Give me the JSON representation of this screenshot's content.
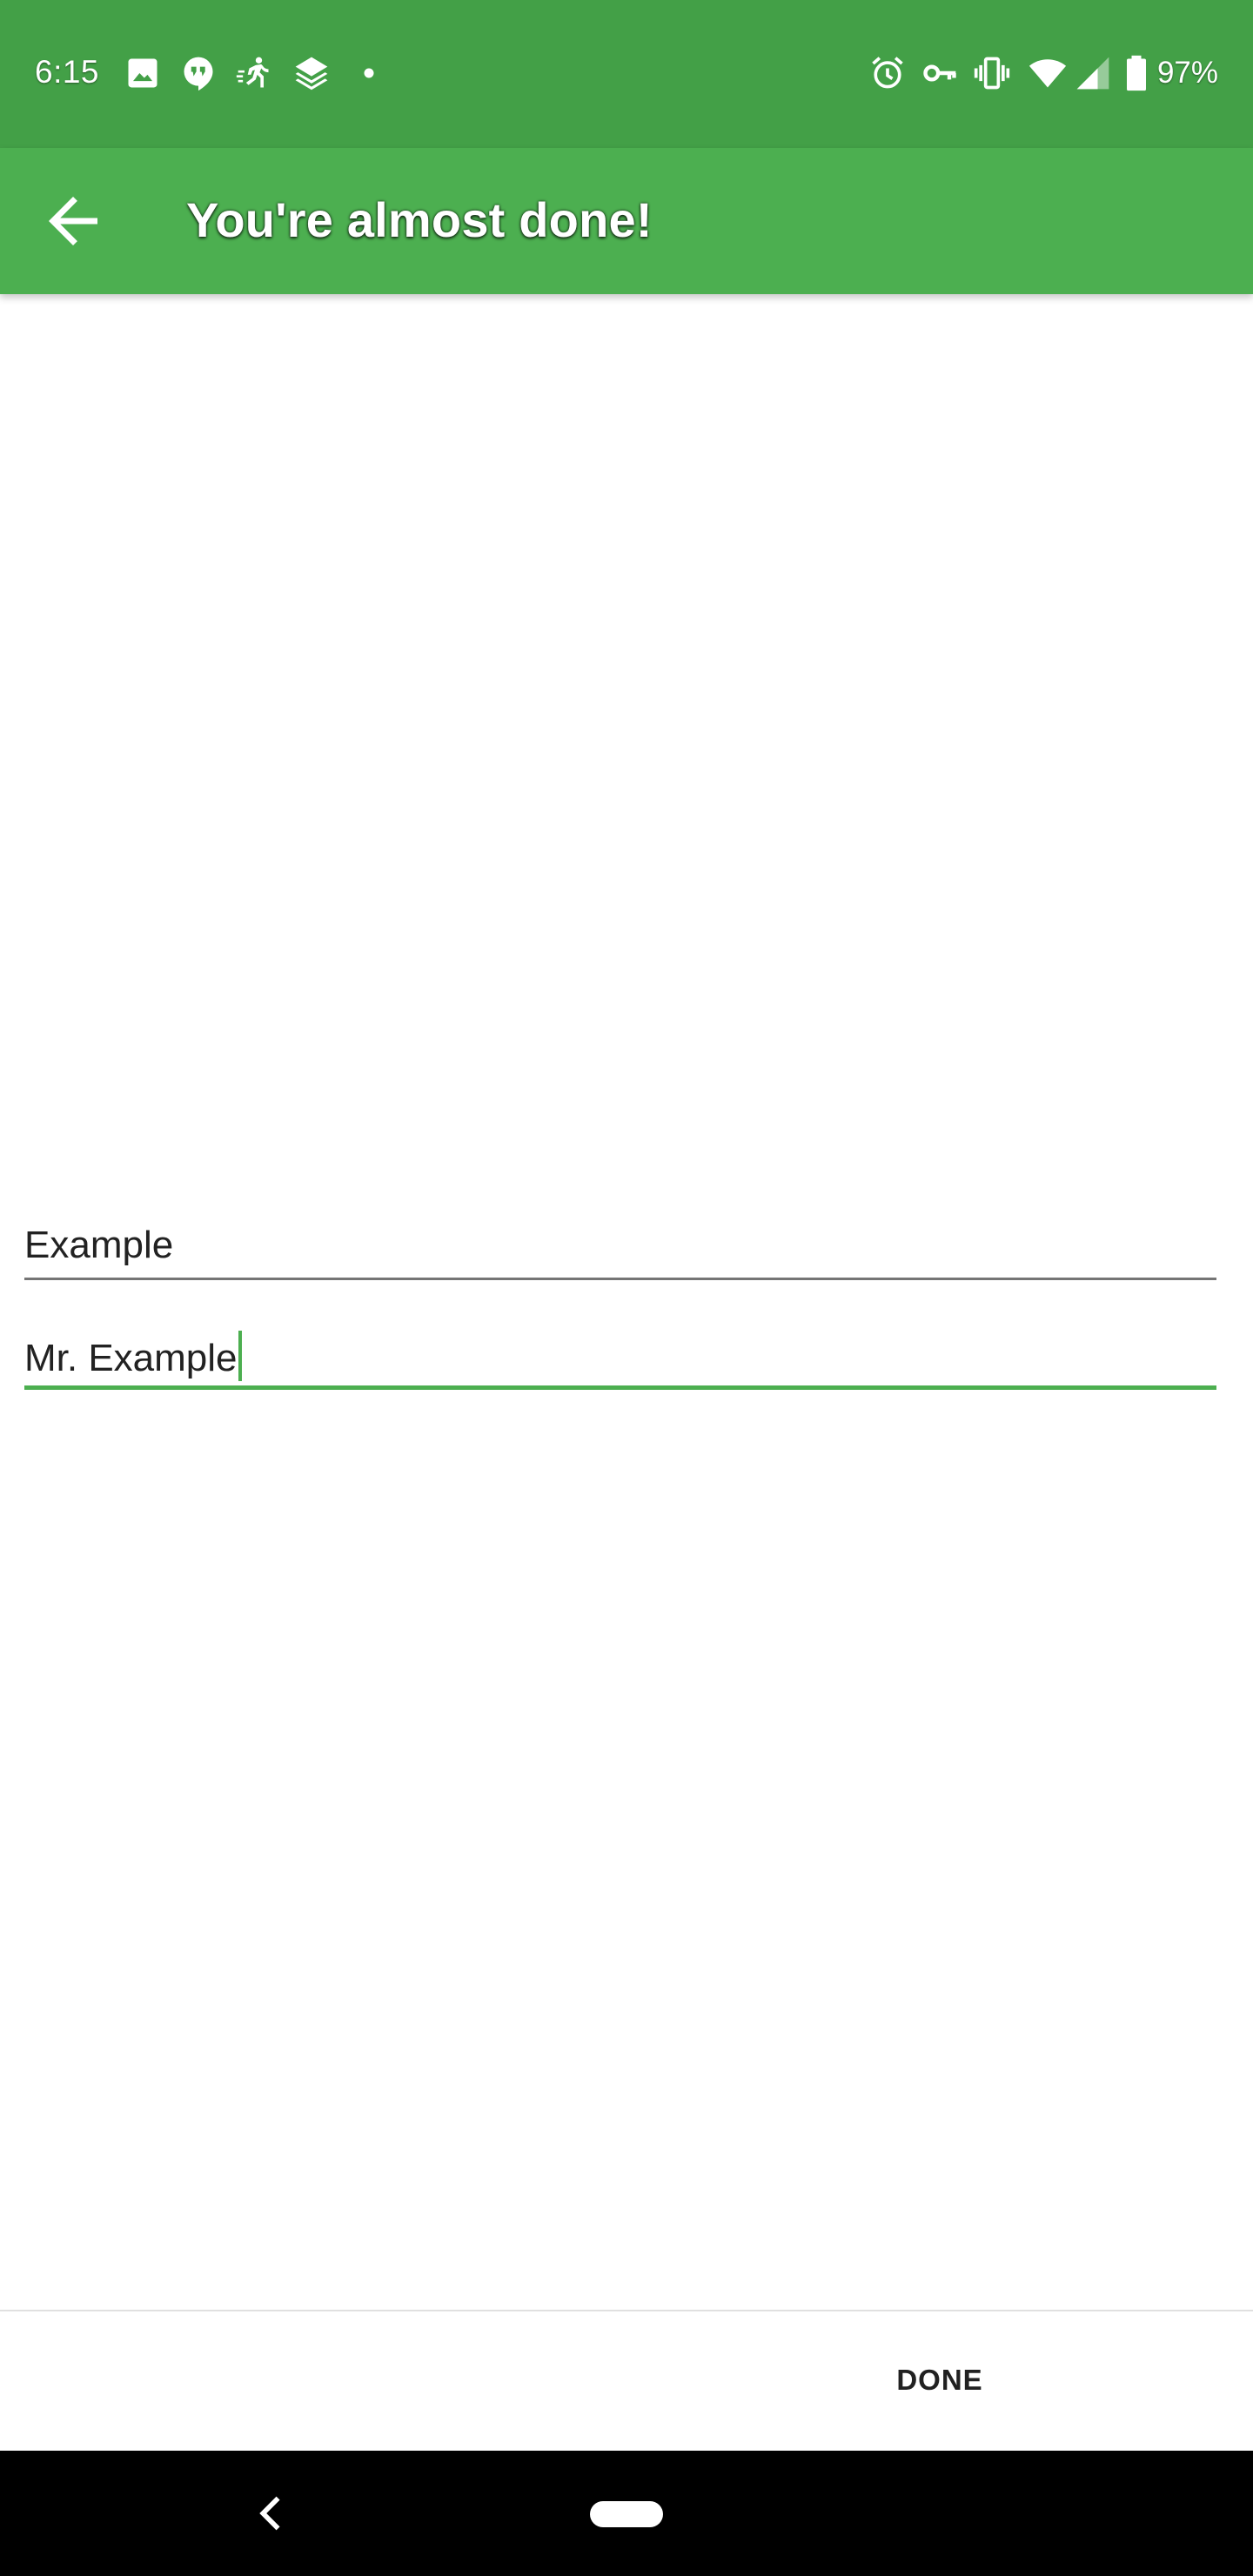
{
  "status_bar": {
    "time": "6:15",
    "battery_percent": "97%",
    "background_color": "#43a047",
    "left_icons": [
      "image-icon",
      "hangouts-icon",
      "running-icon",
      "layers-icon",
      "dot-icon"
    ],
    "right_icons": [
      "alarm-icon",
      "vpn-key-icon",
      "vibrate-icon",
      "wifi-icon",
      "cell-signal-icon",
      "battery-icon"
    ]
  },
  "app_bar": {
    "title": "You're almost done!",
    "background_color": "#4caf50",
    "back_icon": "arrow-back-icon"
  },
  "form": {
    "first_field_value": "Example",
    "second_field_value": "Mr. Example",
    "focused_field": "second"
  },
  "footer": {
    "done_label": "DONE"
  },
  "nav_bar": {
    "back_icon": "nav-back-icon",
    "home_icon": "nav-home-pill"
  }
}
